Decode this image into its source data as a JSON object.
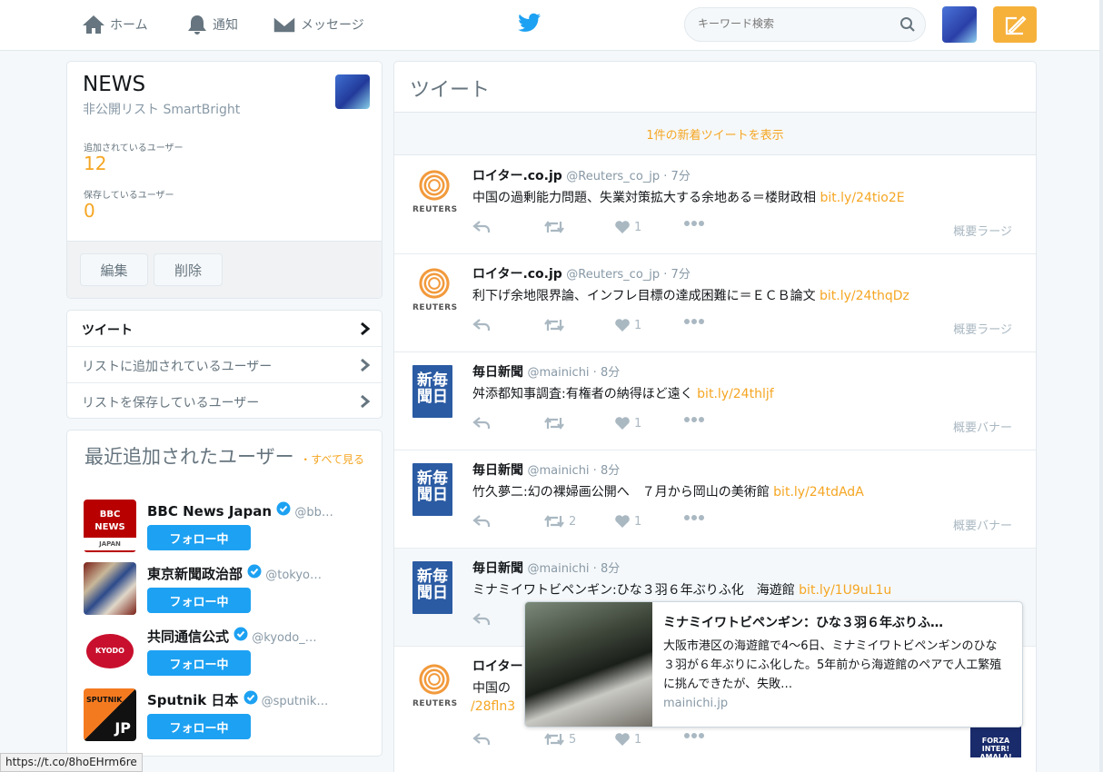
{
  "nav": {
    "home": "ホーム",
    "notifications": "通知",
    "messages": "メッセージ",
    "search_placeholder": "キーワード検索"
  },
  "list": {
    "title": "NEWS",
    "subtitle": "非公開リスト SmartBright",
    "members_label": "追加されているユーザー",
    "members_count": "12",
    "subscribers_label": "保存しているユーザー",
    "subscribers_count": "0",
    "edit_label": "編集",
    "delete_label": "削除"
  },
  "list_nav": [
    {
      "label": "ツイート",
      "active": true
    },
    {
      "label": "リストに追加されているユーザー",
      "active": false
    },
    {
      "label": "リストを保存しているユーザー",
      "active": false
    }
  ],
  "recent_users": {
    "title": "最近追加されたユーザー",
    "see_all": "・すべて見る",
    "users": [
      {
        "name": "BBC News Japan",
        "handle": "@bb…",
        "button": "フォロー中"
      },
      {
        "name": "東京新聞政治部",
        "handle": "@tokyo…",
        "button": "フォロー中"
      },
      {
        "name": "共同通信公式",
        "handle": "@kyodo_…",
        "button": "フォロー中"
      },
      {
        "name": "Sputnik 日本",
        "handle": "@sputnik…",
        "button": "フォロー中"
      }
    ]
  },
  "timeline": {
    "header": "ツイート",
    "new_tweets": "1件の新着ツイートを表示",
    "tweets": [
      {
        "name": "ロイター.co.jp",
        "meta": "@Reuters_co_jp · 7分",
        "text": "中国の過剰能力問題、失業対策拡大する余地ある＝楼財政相 ",
        "link": "bit.ly/24tio2E",
        "retweets": "",
        "likes": "1",
        "summary": "概要ラージ"
      },
      {
        "name": "ロイター.co.jp",
        "meta": "@Reuters_co_jp · 7分",
        "text": "利下げ余地限界論、インフレ目標の達成困難に＝ＥＣＢ論文 ",
        "link": "bit.ly/24thqDz",
        "retweets": "",
        "likes": "1",
        "summary": "概要ラージ"
      },
      {
        "name": "毎日新聞",
        "meta": "@mainichi · 8分",
        "text": "舛添都知事調査:有権者の納得ほど遠く ",
        "link": "bit.ly/24thljf",
        "retweets": "",
        "likes": "1",
        "summary": "概要バナー"
      },
      {
        "name": "毎日新聞",
        "meta": "@mainichi · 8分",
        "text": "竹久夢二:幻の裸婦画公開へ　７月から岡山の美術館 ",
        "link": "bit.ly/24tdAdA",
        "retweets": "2",
        "likes": "1",
        "summary": "概要バナー"
      },
      {
        "name": "毎日新聞",
        "meta": "@mainichi · 8分",
        "text": "ミナミイワトビペンギン:ひな３羽６年ぶりふ化　海遊館 ",
        "link": "bit.ly/1U9uL1u",
        "retweets": "",
        "likes": "",
        "summary": ""
      },
      {
        "name": "ロイター",
        "meta": "",
        "text": "中国の",
        "link": "/28fln3",
        "retweets": "5",
        "likes": "1",
        "summary": ""
      }
    ]
  },
  "popup": {
    "title": "ミナミイワトビペンギン：ひな３羽６年ぶりふ…",
    "description": "大阪市港区の海遊館で4～6日、ミナミイワトビペンギンのひな３羽が６年ぶりにふ化した。5年前から海遊館のペアで人工繁殖に挑んできたが、失敗…",
    "domain": "mainichi.jp"
  },
  "status_url": "https://t.co/8hoEHrm6re",
  "logos": {
    "reuters": "REUTERS",
    "mainichi": [
      "新",
      "毎",
      "聞",
      "日"
    ],
    "bbc": [
      "BBC",
      "NEWS",
      "JAPAN"
    ],
    "kyodo": "KYODO",
    "sputnik": [
      "SPUTNIK",
      "JP"
    ],
    "thumb": [
      "FORZA INTER!",
      "AMALA!"
    ]
  },
  "colors": {
    "accent": "#f5a623",
    "twitter_blue": "#1da1f2"
  }
}
